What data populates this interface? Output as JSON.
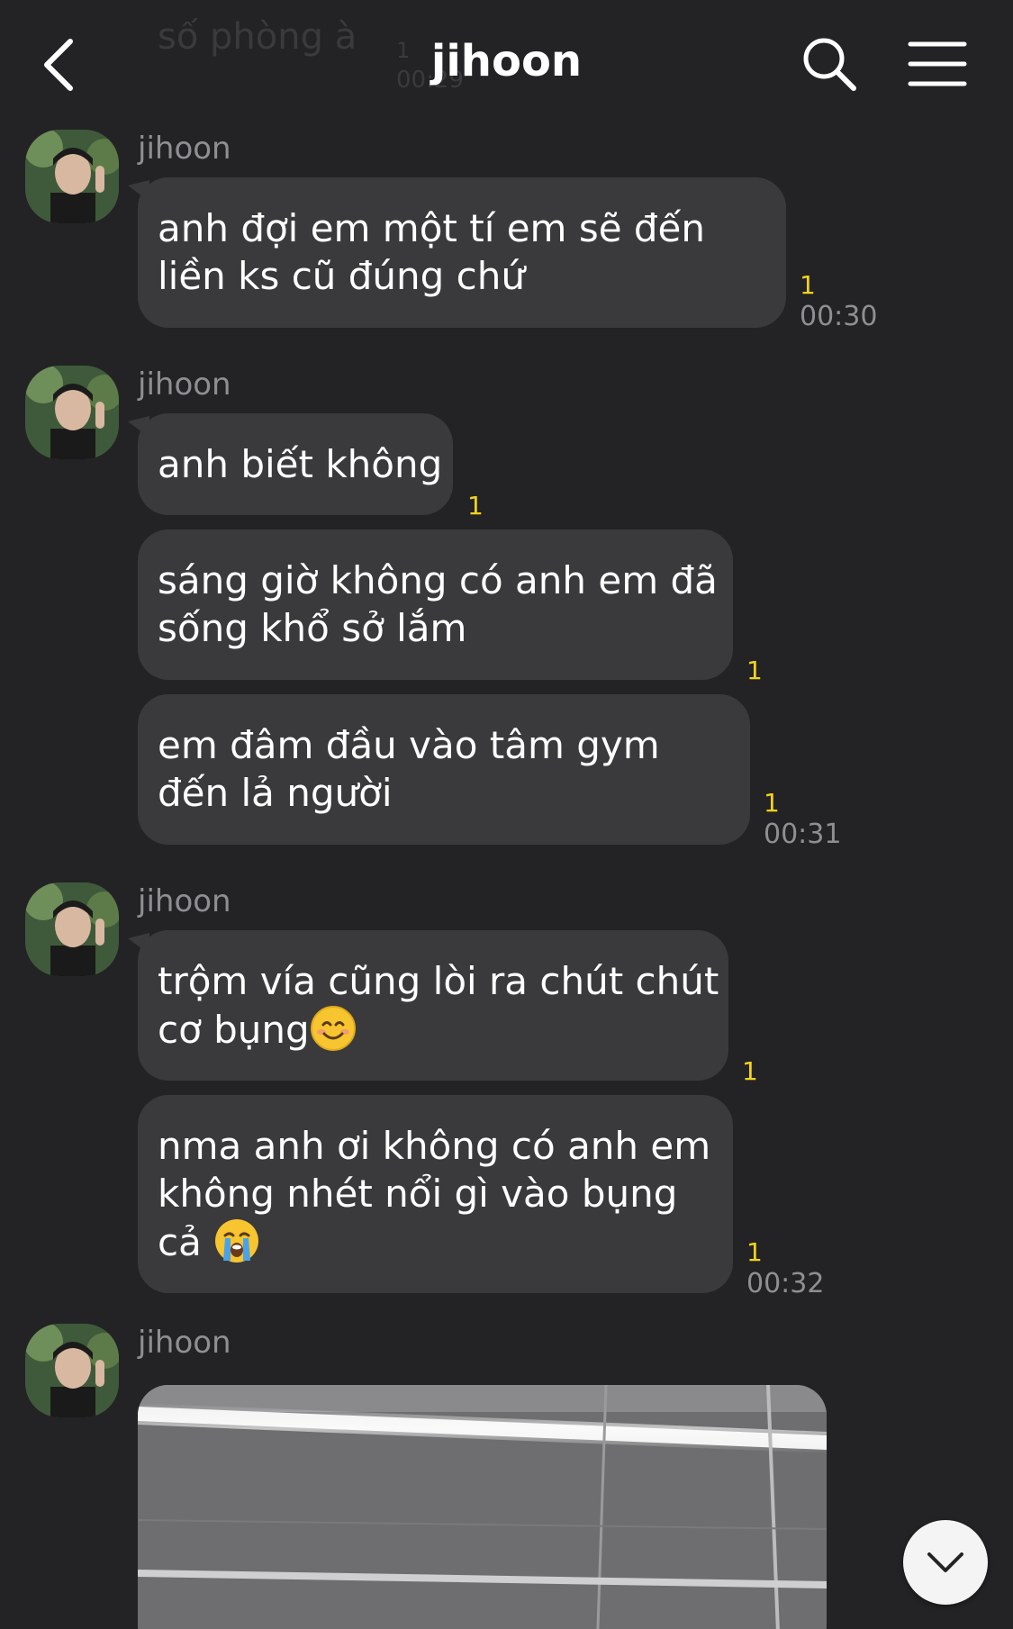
{
  "header": {
    "title": "jihoon",
    "background_preview": {
      "text": "số phòng à",
      "count": "1",
      "time": "00:29"
    }
  },
  "icons": {
    "back": "chevron-left-icon",
    "search": "search-icon",
    "menu": "hamburger-menu-icon",
    "scroll": "chevron-down-icon"
  },
  "colors": {
    "background": "#232325",
    "bubble": "#3a3a3c",
    "unread": "#f2d31b",
    "muted": "#8f8f93"
  },
  "messages": [
    {
      "sender": "jihoon",
      "text": "anh đợi em một tí em sẽ đến liền ks cũ đúng chứ",
      "unread": "1",
      "time": "00:30"
    },
    {
      "sender": "jihoon",
      "text": "anh biết không",
      "unread": "1",
      "time": ""
    },
    {
      "sender": "",
      "text": "sáng giờ không có anh em đã sống khổ sở lắm",
      "unread": "1",
      "time": ""
    },
    {
      "sender": "",
      "text": "em đâm đầu vào tâm gym đến lả người",
      "unread": "1",
      "time": "00:31"
    },
    {
      "sender": "jihoon",
      "text": "trộm vía cũng lòi ra chút chút cơ bụng",
      "emoji": "smiling-face-emoji",
      "unread": "1",
      "time": ""
    },
    {
      "sender": "",
      "text": "nma anh ơi không có anh em không nhét nổi gì vào bụng cả",
      "emoji": "crying-face-emoji",
      "unread": "1",
      "time": "00:32"
    },
    {
      "sender": "jihoon",
      "type": "image"
    }
  ]
}
